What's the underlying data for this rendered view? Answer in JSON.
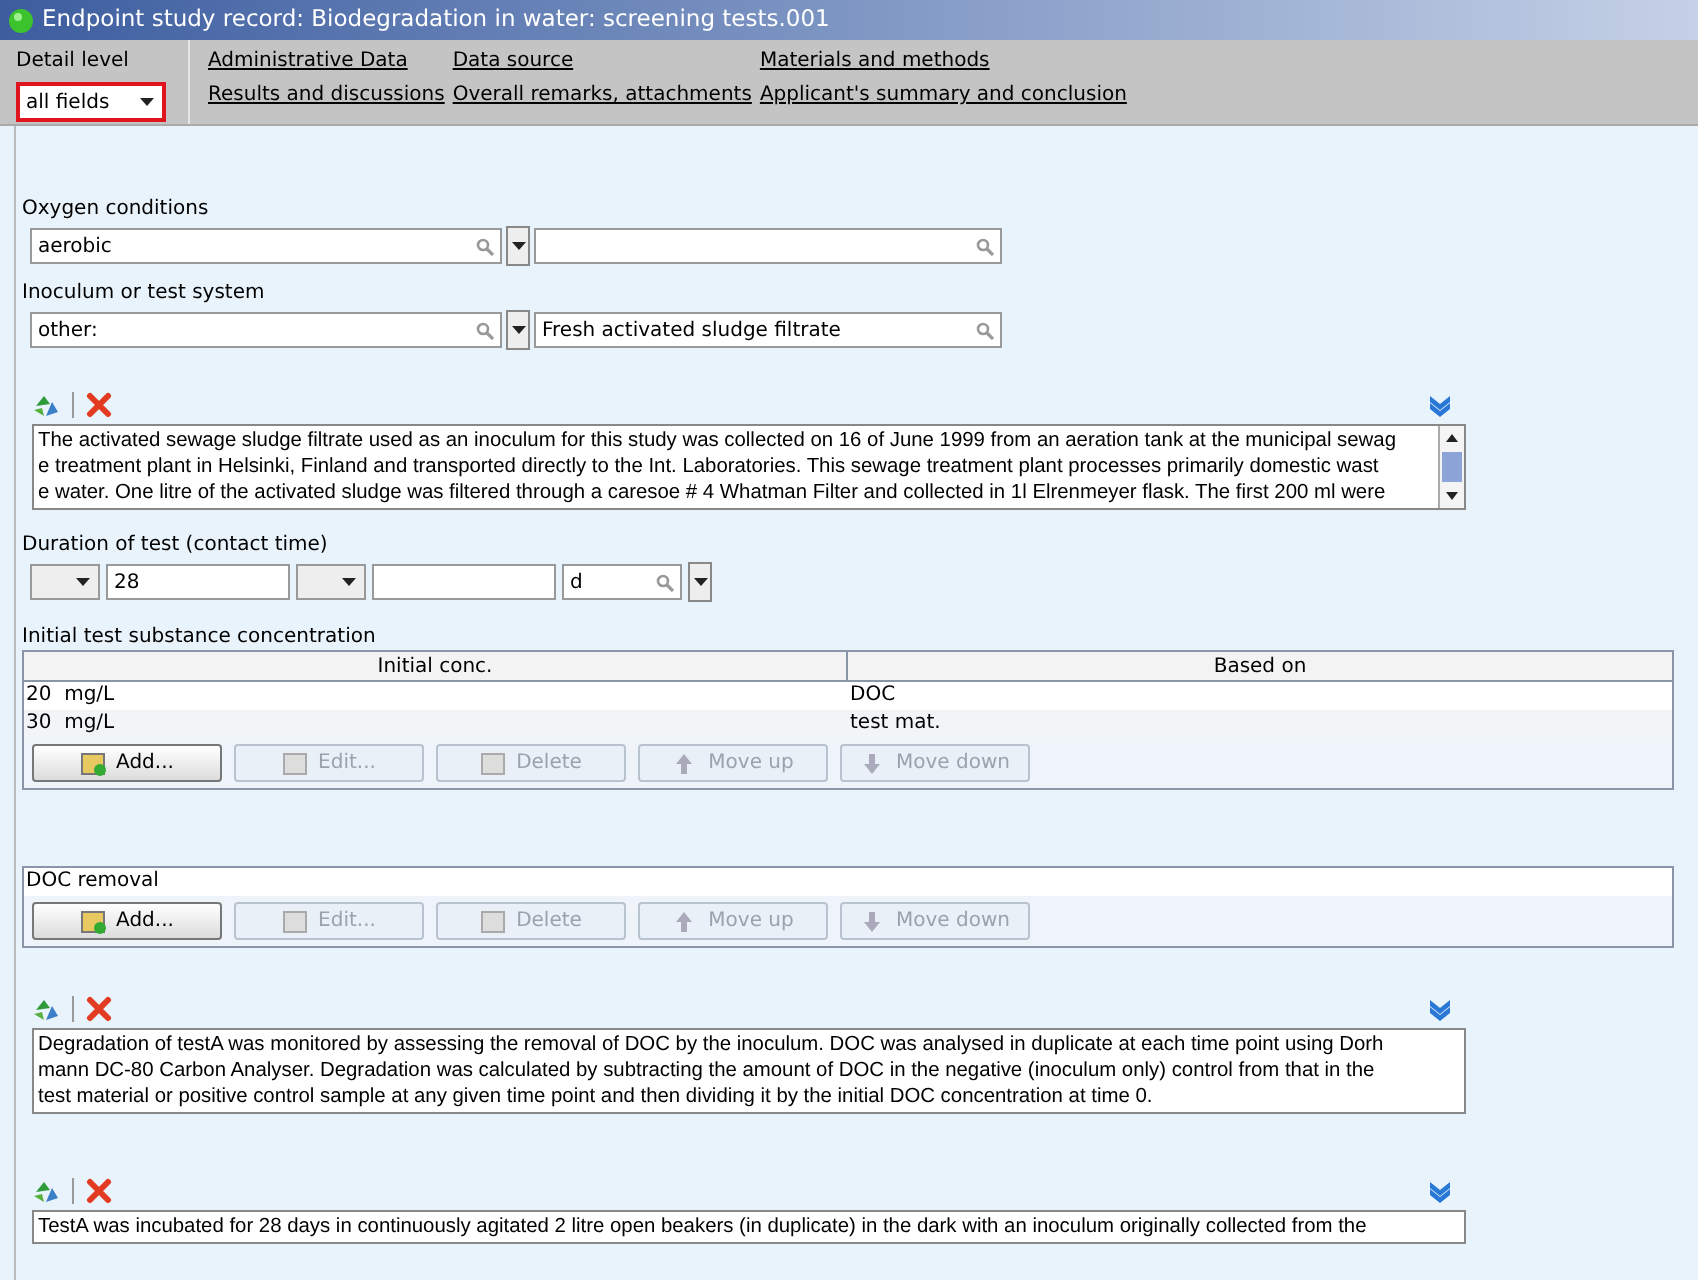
{
  "window": {
    "title": "Endpoint study record: Biodegradation in water: screening tests.001"
  },
  "detail_level": {
    "label": "Detail level",
    "value": "all fields"
  },
  "nav_links": [
    {
      "label": "Administrative Data"
    },
    {
      "label": "Data source"
    },
    {
      "label": "Materials and methods"
    },
    {
      "label": "Results and discussions"
    },
    {
      "label": "Overall remarks, attachments"
    },
    {
      "label": "Applicant's summary and conclusion"
    }
  ],
  "oxygen_conditions": {
    "label": "Oxygen conditions",
    "value": "aerobic"
  },
  "inoculum": {
    "label": "Inoculum or test system",
    "value": "other:",
    "other_value": "Fresh activated sludge filtrate"
  },
  "inoculum_details": {
    "lines": [
      "The activated sewage sludge filtrate used as an inoculum for this study was collected on 16 of June 1999 from an aeration tank at the municipal sewag",
      "e treatment plant in Helsinki, Finland and transported directly to the Int. Laboratories. This sewage treatment plant processes primarily domestic wast",
      "e water. One litre of the activated sludge was filtered through a caresoe # 4 Whatman Filter and collected in 1l Elrenmeyer flask. The first 200 ml were"
    ]
  },
  "duration": {
    "label": "Duration of test (contact time)",
    "value": "28",
    "unit": "d"
  },
  "initial_concentration": {
    "label": "Initial test substance concentration",
    "columns": [
      "Initial conc.",
      "Based on"
    ],
    "rows": [
      [
        "20  mg/L",
        "DOC"
      ],
      [
        "30  mg/L",
        "test mat."
      ]
    ],
    "buttons": [
      {
        "kind": "add",
        "label": "Add...",
        "disabled": false
      },
      {
        "kind": "edit",
        "label": "Edit...",
        "disabled": true
      },
      {
        "kind": "delete",
        "label": "Delete",
        "disabled": true
      },
      {
        "kind": "up",
        "label": "Move up",
        "disabled": true
      },
      {
        "kind": "down",
        "label": "Move down",
        "disabled": true
      }
    ]
  },
  "doc_removal": {
    "rows": [
      "DOC removal"
    ],
    "buttons": [
      {
        "kind": "add",
        "label": "Add...",
        "disabled": false
      },
      {
        "kind": "edit",
        "label": "Edit...",
        "disabled": true
      },
      {
        "kind": "delete",
        "label": "Delete",
        "disabled": true
      },
      {
        "kind": "up",
        "label": "Move up",
        "disabled": true
      },
      {
        "kind": "down",
        "label": "Move down",
        "disabled": true
      }
    ]
  },
  "method_details": {
    "lines": [
      "Degradation of testA was monitored by assessing the removal of DOC by the inoculum. DOC was analysed in duplicate at each time point using Dorh",
      "mann DC-80 Carbon Analyser. Degradation was calculated by subtracting the amount of DOC in the negative (inoculum only) control from that in the",
      "test material or positive control sample at any given time point and then dividing it by the initial DOC concentration at time 0."
    ]
  },
  "incubation_details": {
    "lines": [
      "TestA was incubated for 28 days in continuously agitated 2 litre open beakers (in duplicate) in the dark with an inoculum originally collected from the"
    ]
  }
}
